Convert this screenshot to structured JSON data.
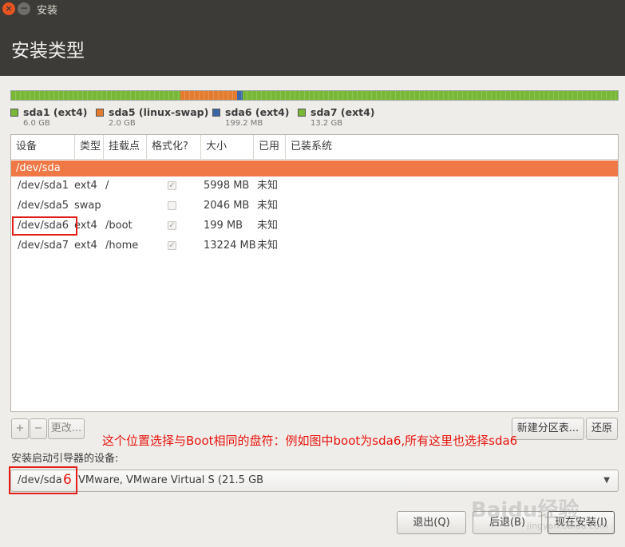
{
  "window": {
    "title": "安装"
  },
  "header": {
    "title": "安装类型"
  },
  "partition_bar": {
    "segments": [
      {
        "name": "sda1 (ext4)",
        "size": "6.0 GB",
        "color": "#78b836",
        "fraction": 0.279
      },
      {
        "name": "sda5 (linux-swap)",
        "size": "2.0 GB",
        "color": "#e47c30",
        "fraction": 0.093
      },
      {
        "name": "sda6 (ext4)",
        "size": "199.2 MB",
        "color": "#3b66a8",
        "fraction": 0.009
      },
      {
        "name": "sda7 (ext4)",
        "size": "13.2 GB",
        "color": "#78b836",
        "fraction": 0.619
      }
    ]
  },
  "table": {
    "headers": [
      "设备",
      "类型",
      "挂载点",
      "格式化?",
      "大小",
      "已用",
      "已装系统"
    ],
    "group": "/dev/sda",
    "rows": [
      {
        "device": "/dev/sda1",
        "type": "ext4",
        "mount": "/",
        "format": true,
        "size": "5998 MB",
        "used": "未知",
        "system": ""
      },
      {
        "device": "/dev/sda5",
        "type": "swap",
        "mount": "",
        "format": false,
        "size": "2046 MB",
        "used": "未知",
        "system": ""
      },
      {
        "device": "/dev/sda6",
        "type": "ext4",
        "mount": "/boot",
        "format": true,
        "size": "199 MB",
        "used": "未知",
        "system": ""
      },
      {
        "device": "/dev/sda7",
        "type": "ext4",
        "mount": "/home",
        "format": true,
        "size": "13224 MB",
        "used": "未知",
        "system": ""
      }
    ]
  },
  "toolbar": {
    "add": "+",
    "remove": "−",
    "change": "更改...",
    "new_table": "新建分区表...",
    "revert": "还原"
  },
  "annotation": {
    "text": "这个位置选择与Boot相同的盘符：例如图中boot为sda6,所有这里也选择sda6",
    "digit": "6"
  },
  "bootloader": {
    "label": "安装启动引导器的设备:",
    "device_prefix": "/dev/sda",
    "device_suffix": "VMware, VMware Virtual S (21.5 GB"
  },
  "buttons": {
    "quit": "退出(Q)",
    "back": "后退(B)",
    "install": "现在安装(I)"
  },
  "watermark": {
    "text": "Baidu经验",
    "sub": "jingyan.baidu.com"
  },
  "icons": {
    "close": "×",
    "minimize": "−",
    "check": "✓",
    "dropdown": "▼"
  }
}
